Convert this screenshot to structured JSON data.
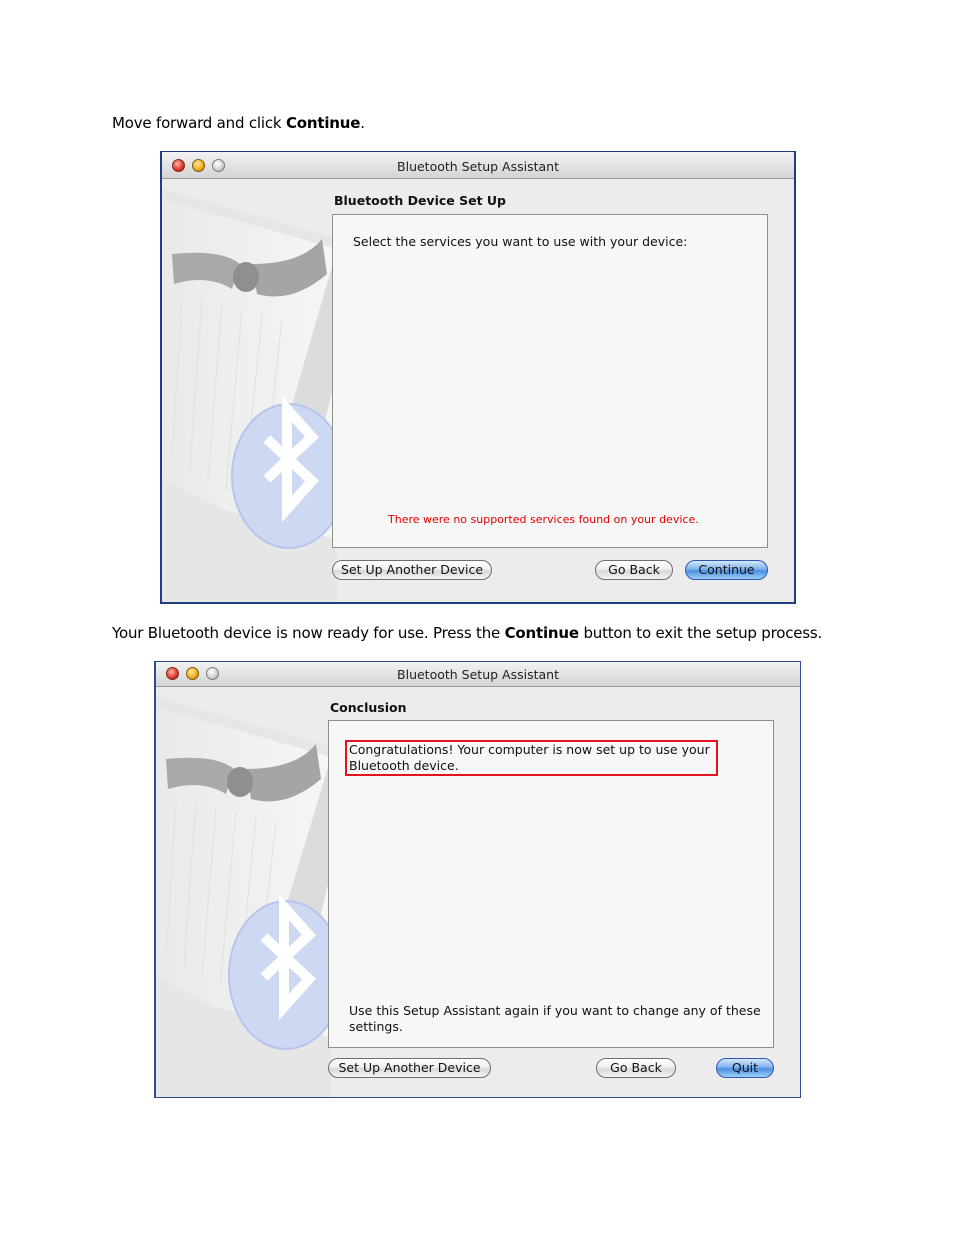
{
  "doc": {
    "para1": {
      "prefix": "Move forward and click ",
      "bold": "Continue",
      "suffix": "."
    },
    "para2": {
      "prefix": "Your Bluetooth device is now ready for use. Press the ",
      "bold": "Continue",
      "suffix": " button to exit the setup process."
    }
  },
  "window1": {
    "title": "Bluetooth Setup Assistant",
    "heading": "Bluetooth Device Set Up",
    "instruction": "Select the services you want to use with your device:",
    "error": "There were no supported services found on your device.",
    "buttons": {
      "setup_another": "Set Up Another Device",
      "go_back": "Go Back",
      "continue": "Continue"
    }
  },
  "window2": {
    "title": "Bluetooth Setup Assistant",
    "heading": "Conclusion",
    "congrats_line1": "Congratulations! Your computer is now set up to use your",
    "congrats_line2": "Bluetooth device.",
    "footer_line1": "Use this Setup Assistant again if you want to change any of these",
    "footer_line2": "settings.",
    "buttons": {
      "setup_another": "Set Up Another Device",
      "go_back": "Go Back",
      "quit": "Quit"
    }
  },
  "colors": {
    "highlight": "#e3141f",
    "error_text": "#e00000",
    "primary_button": "#4b8fe0",
    "window_border": "#1d3f82"
  },
  "icons": {
    "art": "bluetooth-tuxedo-icon",
    "close": "close-light-icon",
    "minimize": "minimize-light-icon",
    "zoom": "zoom-light-icon"
  }
}
